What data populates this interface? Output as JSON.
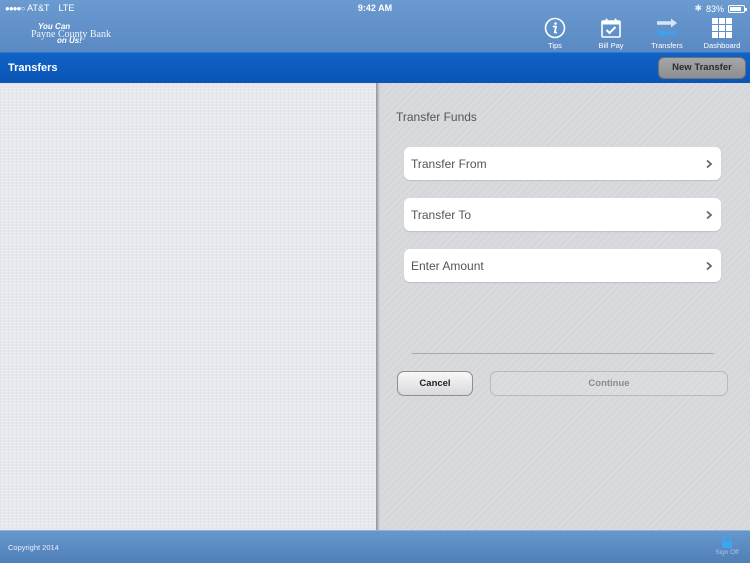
{
  "status_bar": {
    "signal_dots": "●●●●○",
    "carrier": "AT&T",
    "network": "LTE",
    "time": "9:42 AM",
    "battery_percent": "83%",
    "battery_level": 0.83
  },
  "logo": {
    "line1": "You Can",
    "line2": "Payne County Bank",
    "line3": "on Us!"
  },
  "nav": {
    "items": [
      {
        "label": "Tips",
        "icon": "info-icon"
      },
      {
        "label": "Bill Pay",
        "icon": "calendar-check-icon"
      },
      {
        "label": "Transfers",
        "icon": "transfer-arrows-icon"
      },
      {
        "label": "Dashboard",
        "icon": "grid-icon"
      }
    ]
  },
  "header": {
    "title": "Transfers",
    "new_transfer_label": "New Transfer"
  },
  "form": {
    "section_title": "Transfer Funds",
    "fields": [
      {
        "label": "Transfer From"
      },
      {
        "label": "Transfer To"
      },
      {
        "label": "Enter Amount"
      }
    ],
    "cancel_label": "Cancel",
    "continue_label": "Continue"
  },
  "footer": {
    "copyright": "Copyright 2014",
    "sign_off_label": "Sign Off"
  },
  "colors": {
    "top_bar": "#5f8fc8",
    "title_bar": "#0d5bbd",
    "footer": "#5a8ac2"
  }
}
